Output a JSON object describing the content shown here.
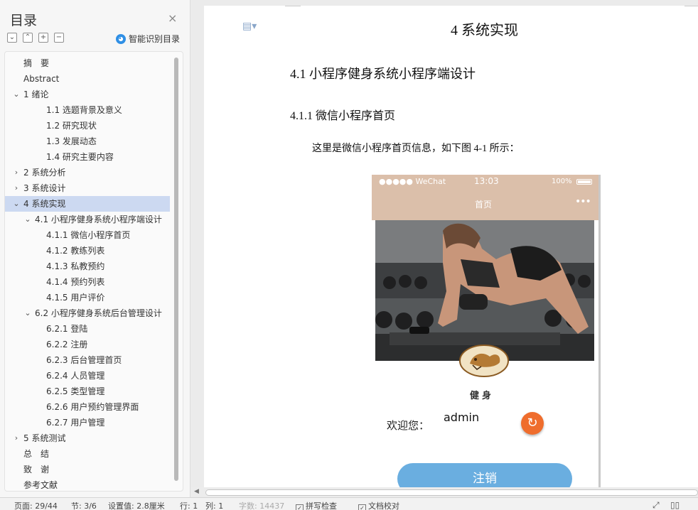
{
  "toc": {
    "title": "目录",
    "close_icon": "×",
    "tool_icons": [
      "collapse-all-icon",
      "expand-all-icon",
      "add-level-icon",
      "remove-level-icon"
    ],
    "smart_label": "智能识别目录",
    "items": [
      {
        "label": "摘　要",
        "level": 0,
        "chevron": ""
      },
      {
        "label": "Abstract",
        "level": 0,
        "chevron": ""
      },
      {
        "label": "1 绪论",
        "level": 0,
        "chevron": "down"
      },
      {
        "label": "1.1 选题背景及意义",
        "level": 2,
        "chevron": ""
      },
      {
        "label": "1.2 研究现状",
        "level": 2,
        "chevron": ""
      },
      {
        "label": "1.3 发展动态",
        "level": 2,
        "chevron": ""
      },
      {
        "label": "1.4 研究主要内容",
        "level": 2,
        "chevron": ""
      },
      {
        "label": "2 系统分析",
        "level": 0,
        "chevron": "right"
      },
      {
        "label": "3 系统设计",
        "level": 0,
        "chevron": "right"
      },
      {
        "label": "4 系统实现",
        "level": 0,
        "chevron": "down",
        "active": true
      },
      {
        "label": "4.1 小程序健身系统小程序端设计",
        "level": 1,
        "chevron": "down"
      },
      {
        "label": "4.1.1 微信小程序首页",
        "level": 3,
        "chevron": ""
      },
      {
        "label": "4.1.2 教练列表",
        "level": 3,
        "chevron": ""
      },
      {
        "label": "4.1.3 私教预约",
        "level": 3,
        "chevron": ""
      },
      {
        "label": "4.1.4 预约列表",
        "level": 3,
        "chevron": ""
      },
      {
        "label": "4.1.5 用户评价",
        "level": 3,
        "chevron": ""
      },
      {
        "label": "6.2 小程序健身系统后台管理设计",
        "level": 1,
        "chevron": "down"
      },
      {
        "label": "6.2.1 登陆",
        "level": 3,
        "chevron": ""
      },
      {
        "label": "6.2.2 注册",
        "level": 3,
        "chevron": ""
      },
      {
        "label": "6.2.3 后台管理首页",
        "level": 3,
        "chevron": ""
      },
      {
        "label": "6.2.4 人员管理",
        "level": 3,
        "chevron": ""
      },
      {
        "label": "6.2.5 类型管理",
        "level": 3,
        "chevron": ""
      },
      {
        "label": "6.2.6 用户预约管理界面",
        "level": 3,
        "chevron": ""
      },
      {
        "label": "6.2.7 用户管理",
        "level": 3,
        "chevron": ""
      },
      {
        "label": "5 系统测试",
        "level": 0,
        "chevron": "right"
      },
      {
        "label": "总　结",
        "level": 0,
        "chevron": ""
      },
      {
        "label": "致　谢",
        "level": 0,
        "chevron": ""
      },
      {
        "label": "参考文献",
        "level": 0,
        "chevron": ""
      }
    ]
  },
  "doc": {
    "chapter": "4 系统实现",
    "section": "4.1 小程序健身系统小程序端设计",
    "subsection": "4.1.1 微信小程序首页",
    "paragraph": "这里是微信小程序首页信息，如下图 4-1 所示："
  },
  "phone": {
    "carrier": "●●●●● WeChat",
    "time": "13:03",
    "battery": "100%",
    "title": "首页",
    "more": "•••",
    "logo_text": "健身",
    "welcome": "欢迎您：",
    "username": "admin",
    "logout": "注销"
  },
  "status": {
    "page": "页面: 29/44",
    "section": "节: 3/6",
    "setting": "设置值: 2.8厘米",
    "row": "行: 1",
    "col": "列: 1",
    "words": "字数: 14437",
    "spell": "拼写检查",
    "proof": "文档校对"
  },
  "colors": {
    "accent_active": "#ccd9f1",
    "phone_bar": "#dbbfaa",
    "logout_button": "#6aaee0",
    "refresh_button": "#ef6d2d"
  }
}
